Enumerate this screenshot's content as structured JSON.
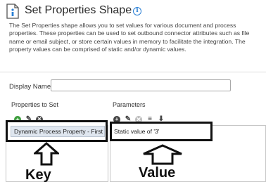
{
  "header": {
    "title": "Set Properties Shape",
    "icon": "set-properties-shape-icon",
    "info_icon": "info-icon",
    "info_glyph": "i"
  },
  "description": "The Set Properties shape allows you to set values for various document and process properties. These properties can be used to set outbound connector attributes such as file name or email subject, or store certain values in memory to facilitate the integration. The property values can be comprised of static and/or dynamic values.",
  "form": {
    "display_name_label": "Display Name",
    "display_name_value": ""
  },
  "properties": {
    "label": "Properties to Set",
    "items": [
      "Dynamic Process Property - First"
    ]
  },
  "parameters": {
    "label": "Parameters",
    "items": [
      "Static value of '3'"
    ]
  },
  "annotations": {
    "key_caption": "Key",
    "value_caption": "Value"
  },
  "colors": {
    "accent": "#2a7fd4",
    "add_green": "#3a9b3a",
    "selected_row": "#dfe6ef"
  }
}
